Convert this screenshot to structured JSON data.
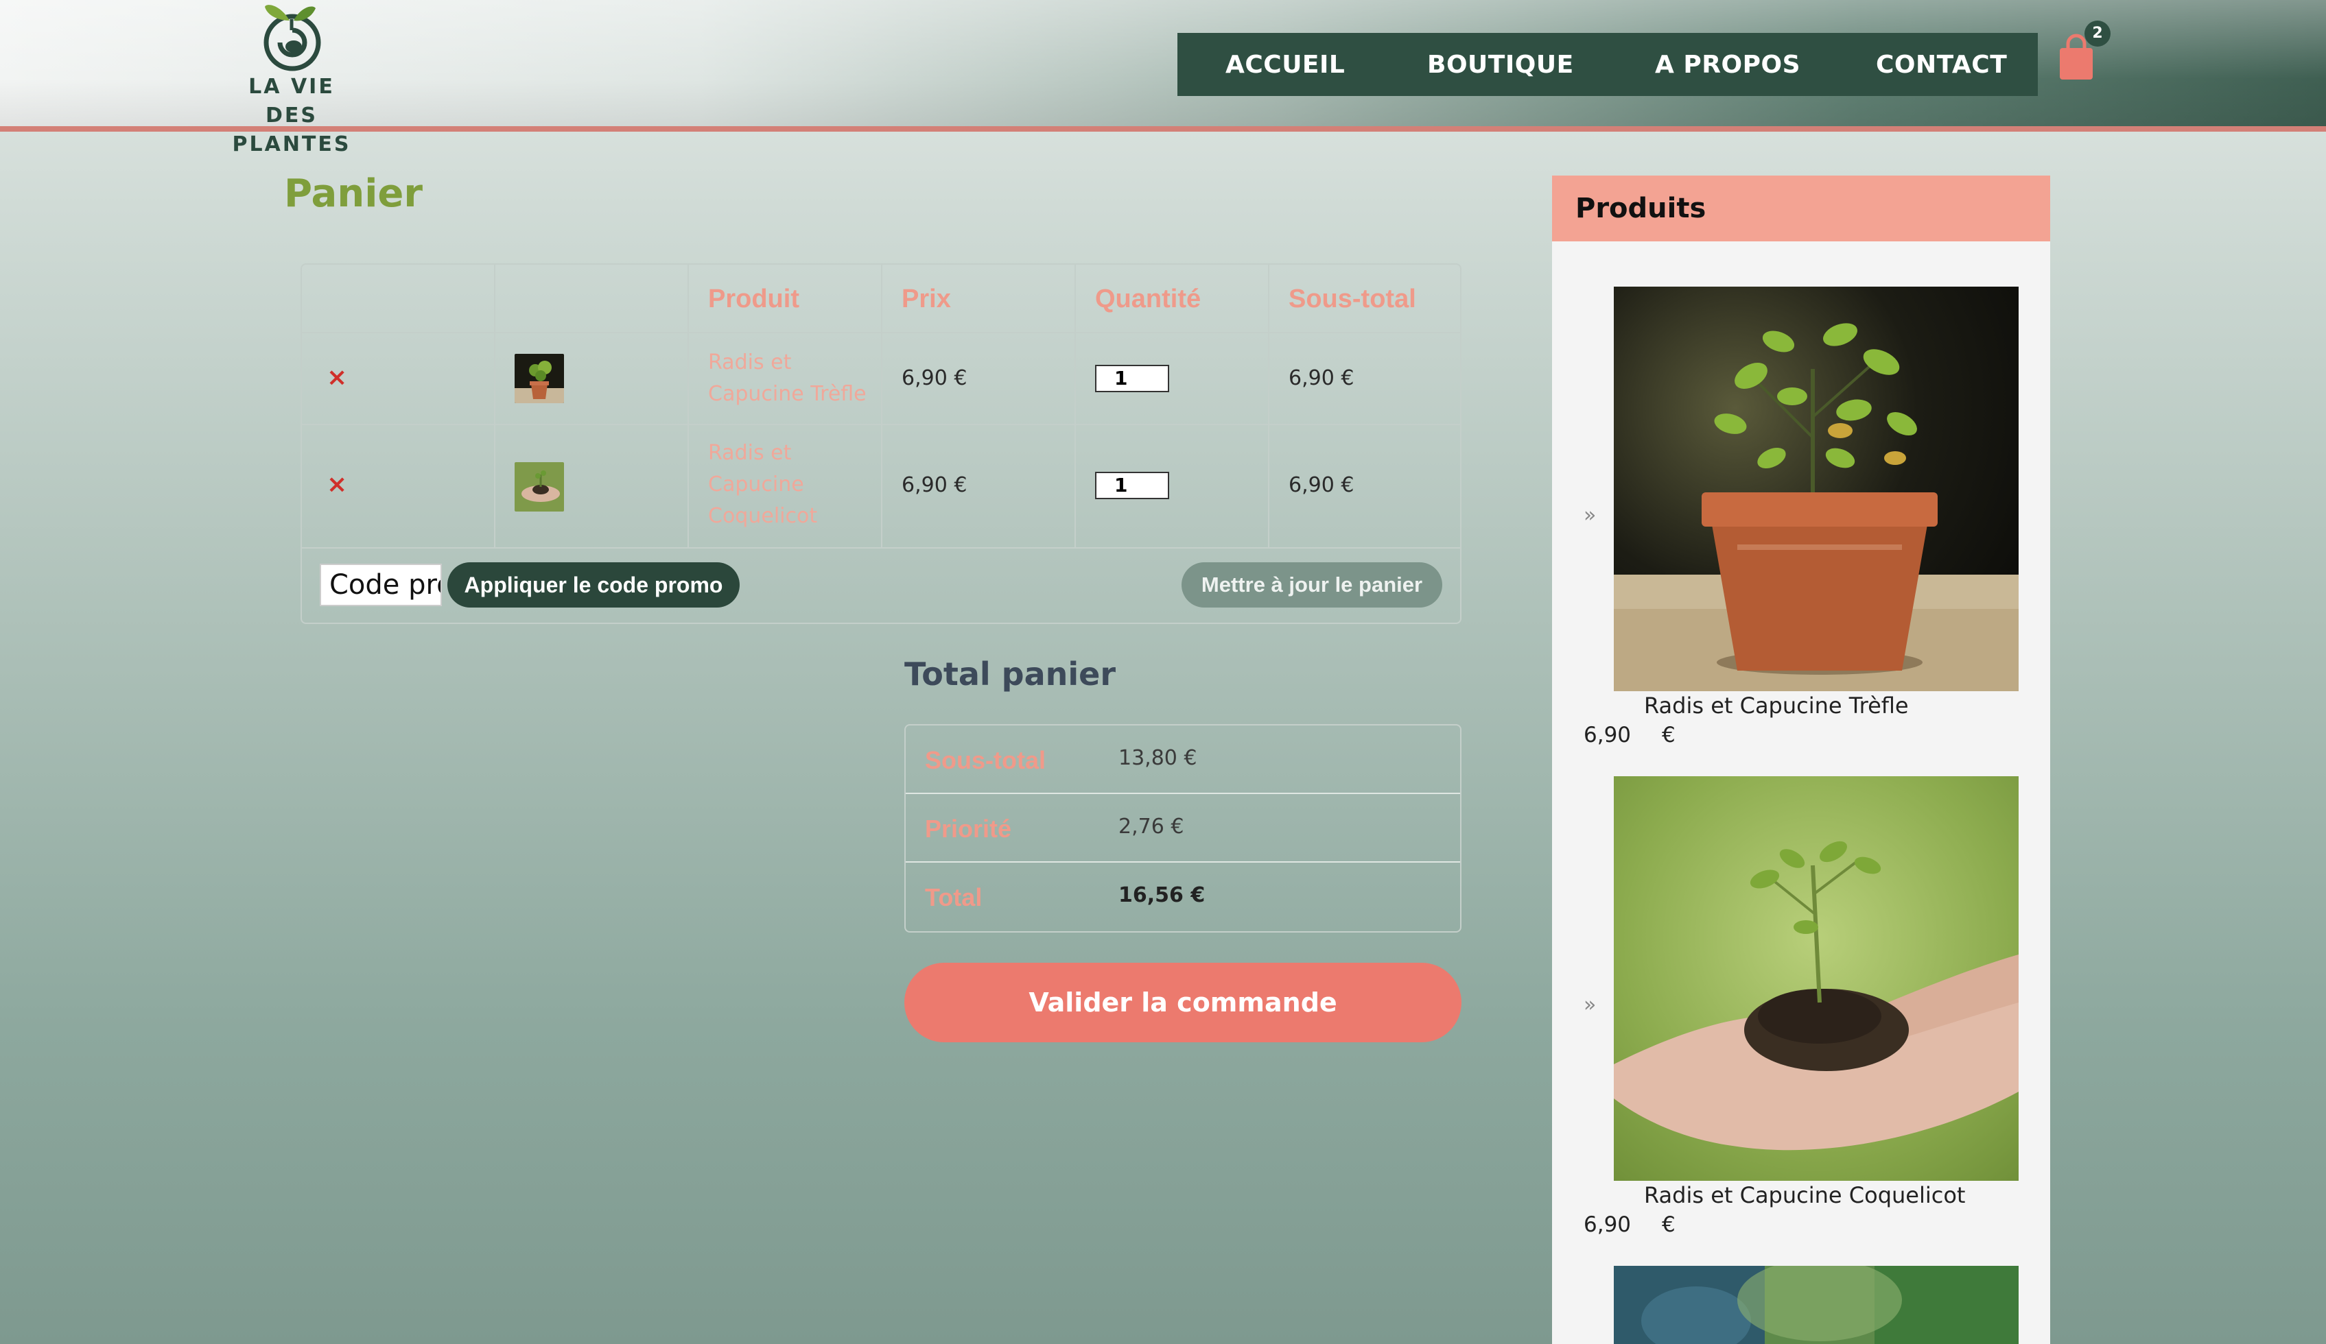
{
  "brand": {
    "line1": "LA VIE DES",
    "line2": "PLANTES"
  },
  "nav": {
    "items": [
      "ACCUEIL",
      "BOUTIQUE",
      "A PROPOS",
      "CONTACT"
    ]
  },
  "cart": {
    "count": "2"
  },
  "page": {
    "title": "Panier"
  },
  "table": {
    "headers": [
      "",
      "",
      "Produit",
      "Prix",
      "Quantité",
      "Sous-total"
    ],
    "rows": [
      {
        "remove": "×",
        "name": "Radis et Capucine Trèfle",
        "price": "6,90 €",
        "qty": "1",
        "subtotal": "6,90 €"
      },
      {
        "remove": "×",
        "name": "Radis et Capucine Coquelicot",
        "price": "6,90 €",
        "qty": "1",
        "subtotal": "6,90 €"
      }
    ],
    "coupon_placeholder": "Code promo",
    "apply_label": "Appliquer le code promo",
    "update_label": "Mettre à jour le panier"
  },
  "totals": {
    "title": "Total panier",
    "rows": [
      {
        "label": "Sous-total",
        "value": "13,80 €"
      },
      {
        "label": "Priorité",
        "value": "2,76 €"
      },
      {
        "label": "Total",
        "value": "16,56 €"
      }
    ],
    "checkout_label": "Valider la commande"
  },
  "sidebar": {
    "title": "Produits",
    "chevron": "»",
    "products": [
      {
        "name": "Radis et Capucine Trèfle",
        "price": "6,90",
        "currency": "€"
      },
      {
        "name": "Radis et Capucine Coquelicot",
        "price": "6,90",
        "currency": "€"
      }
    ]
  },
  "colors": {
    "nav_bg": "#2f4f42",
    "accent": "#ec7a6e",
    "title_green": "#7f9e3c",
    "header_label": "#ef9a8a",
    "cart_icon": "#ec7a6e"
  }
}
